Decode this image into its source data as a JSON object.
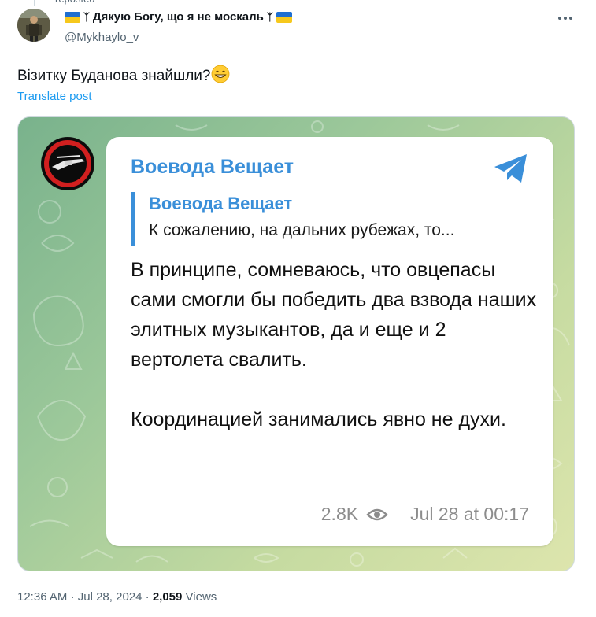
{
  "header": {
    "repost_note": "reposted",
    "display_name": "Дякую Богу, що я не москаль",
    "handle": "@Mykhaylo_v"
  },
  "post": {
    "text": "Візитку Буданова знайшли?",
    "translate_label": "Translate post"
  },
  "telegram": {
    "channel_name": "Воевода Вещает",
    "quote_name": "Воевода Вещает",
    "quote_text": "К сожалению, на дальних рубежах, то...",
    "message_p1": "В принципе, сомневаюсь, что овцепасы сами смогли бы победить два взвода наших элитных музыкантов, да и еще и 2 вертолета свалить.",
    "message_p2": "Координацией занимались явно не духи.",
    "views": "2.8K",
    "timestamp": "Jul 28 at 00:17"
  },
  "footer": {
    "time": "12:36 AM",
    "date": "Jul 28, 2024",
    "views_count": "2,059",
    "views_label": "Views"
  },
  "colors": {
    "link": "#1d9bf0",
    "telegram_blue": "#3a8fd9",
    "ukraine_blue": "#1f6fd1",
    "ukraine_yellow": "#f6c81c"
  },
  "icons": [
    "more-icon",
    "grin-emoji-icon",
    "trident-icon",
    "telegram-logo-icon",
    "eye-icon"
  ]
}
